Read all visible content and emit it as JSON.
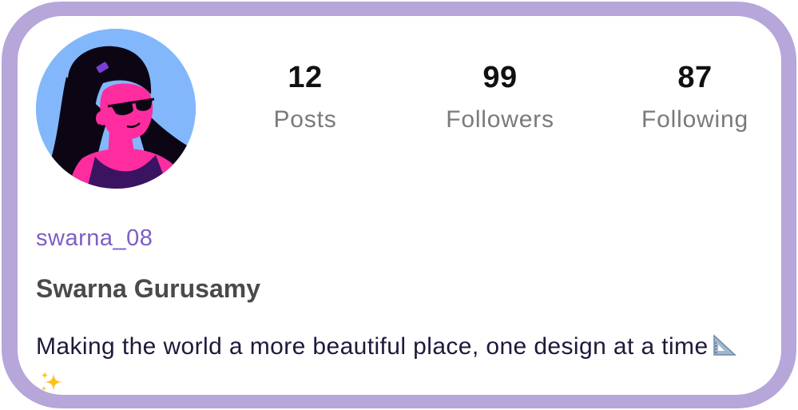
{
  "profile": {
    "avatar_icon": "woman-with-sunglasses-avatar",
    "handle": "swarna_08",
    "name": "Swarna Gurusamy",
    "bio": "Making the world a more beautiful place, one design at a time",
    "bio_emojis": [
      "triangular-ruler-emoji",
      "sparkles-emoji"
    ]
  },
  "stats": {
    "posts": {
      "count": "12",
      "label": "Posts"
    },
    "followers": {
      "count": "99",
      "label": "Followers"
    },
    "following": {
      "count": "87",
      "label": "Following"
    }
  },
  "colors": {
    "frame": "#b6a6da",
    "handle": "#7d5ec6",
    "avatar_bg": "#82b8fb",
    "skin": "#ff2ca0",
    "top": "#3a1460"
  }
}
